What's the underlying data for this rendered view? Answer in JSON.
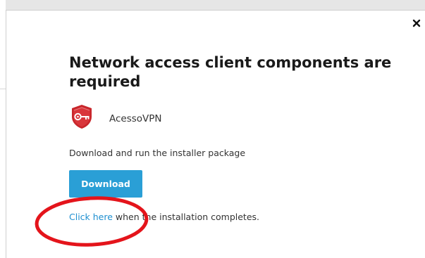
{
  "dialog": {
    "title": "Network access client components are required",
    "app_name": "AcessoVPN",
    "instructions": "Download and run the installer package",
    "download_label": "Download",
    "click_here_label": "Click here",
    "completion_suffix": " when the installation completes.",
    "close_glyph": "×"
  },
  "icons": {
    "close": "close-icon",
    "app": "vpn-shield-key-icon"
  },
  "colors": {
    "primary_button": "#2a9fd6",
    "link": "#1e8fd0",
    "highlight_circle": "#e4141b",
    "app_icon": "#c8262b"
  }
}
